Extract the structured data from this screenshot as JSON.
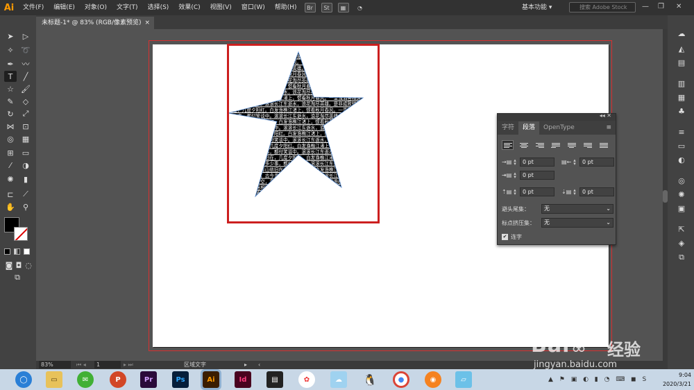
{
  "app": {
    "logo": "Ai"
  },
  "menu": [
    "文件(F)",
    "编辑(E)",
    "对象(O)",
    "文字(T)",
    "选择(S)",
    "效果(C)",
    "视图(V)",
    "窗口(W)",
    "帮助(H)"
  ],
  "menu_buttons": [
    "Br",
    "St"
  ],
  "workspace": "基本功能 ▾",
  "stock_search": {
    "placeholder": "搜索 Adobe Stock"
  },
  "document_tab": {
    "title": "未标题-1* @ 83% (RGB/像素预览)",
    "close": "×"
  },
  "paragraph_panel": {
    "tabs": [
      "字符",
      "段落",
      "OpenType"
    ],
    "active_tab": "段落",
    "indent_left": "0 pt",
    "indent_right": "0 pt",
    "first_line": "0 pt",
    "space_before": "0 pt",
    "space_after": "0 pt",
    "kinsoku_label": "避头尾集：",
    "kinsoku_value": "无",
    "mojikumi_label": "标点挤压集：",
    "mojikumi_value": "无",
    "hyphenate_label": "连字",
    "hyphenate_checked": true
  },
  "statusbar": {
    "zoom": "83%",
    "page": "1",
    "mode_text": "区域文字"
  },
  "star_text_lines": [
    "滚滚长江东逝水，浪花淘尽英雄。是非成败转头空，青山依旧在，",
    "几度夕阳红。白发渔樵江渚上，惯看秋月春风。一壶浊酒喜相逢，",
    "古今多少事，都付笑谈中。"
  ],
  "taskbar": {
    "apps": [
      "Pr",
      "Ps",
      "Ai",
      "Id"
    ],
    "active_app": "Ai",
    "time": "9:04",
    "date": "2020/3/21"
  },
  "watermark": {
    "brand": "Bai",
    "brand2": "经验",
    "url": "jingyan.baidu.com"
  }
}
